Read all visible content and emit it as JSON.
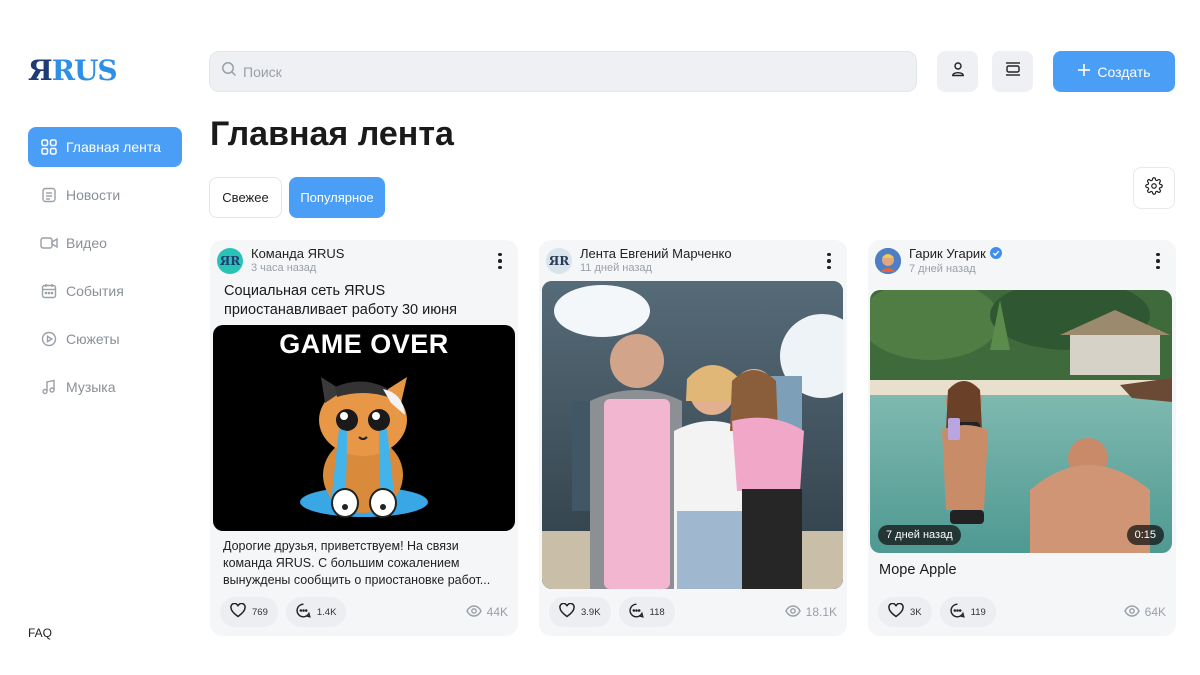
{
  "brand": {
    "logo_ya": "Я",
    "logo_rus": "RUS"
  },
  "sidebar": {
    "items": [
      {
        "label": "Главная лента",
        "icon": "grid-icon",
        "active": true
      },
      {
        "label": "Новости",
        "icon": "news-icon",
        "active": false
      },
      {
        "label": "Видео",
        "icon": "video-icon",
        "active": false
      },
      {
        "label": "События",
        "icon": "calendar-icon",
        "active": false
      },
      {
        "label": "Сюжеты",
        "icon": "play-circle-icon",
        "active": false
      },
      {
        "label": "Музыка",
        "icon": "music-note-icon",
        "active": false
      }
    ],
    "faq": "FAQ"
  },
  "header": {
    "search_placeholder": "Поиск",
    "create_label": "Создать"
  },
  "main": {
    "title": "Главная лента",
    "tabs": [
      {
        "label": "Свежее",
        "active": false
      },
      {
        "label": "Популярное",
        "active": true
      }
    ]
  },
  "posts": [
    {
      "author": "Команда ЯRUS",
      "time": "3 часа назад",
      "title": "Социальная сеть ЯRUS приостанавливает работу 30 июня",
      "image_text": "GAME OVER",
      "text": "Дорогие друзья, приветствуем! На связи команда ЯRUS. С большим сожалением вынуждены сообщить о приостановке работ...",
      "likes": "769",
      "comments": "1.4K",
      "views": "44K"
    },
    {
      "author": "Лента Евгений Марченко",
      "time": "11 дней назад",
      "likes": "3.9K",
      "comments": "118",
      "views": "18.1K"
    },
    {
      "author": "Гарик Угарик",
      "verified": true,
      "time": "7 дней назад",
      "video_badge": "7 дней назад",
      "duration": "0:15",
      "caption": "Море Apple",
      "likes": "3K",
      "comments": "119",
      "views": "64K"
    }
  ],
  "colors": {
    "accent": "#4a9ef5",
    "logo_dark": "#1f3b73",
    "logo_light": "#2f8fe6",
    "card_bg": "#f5f6f8"
  }
}
